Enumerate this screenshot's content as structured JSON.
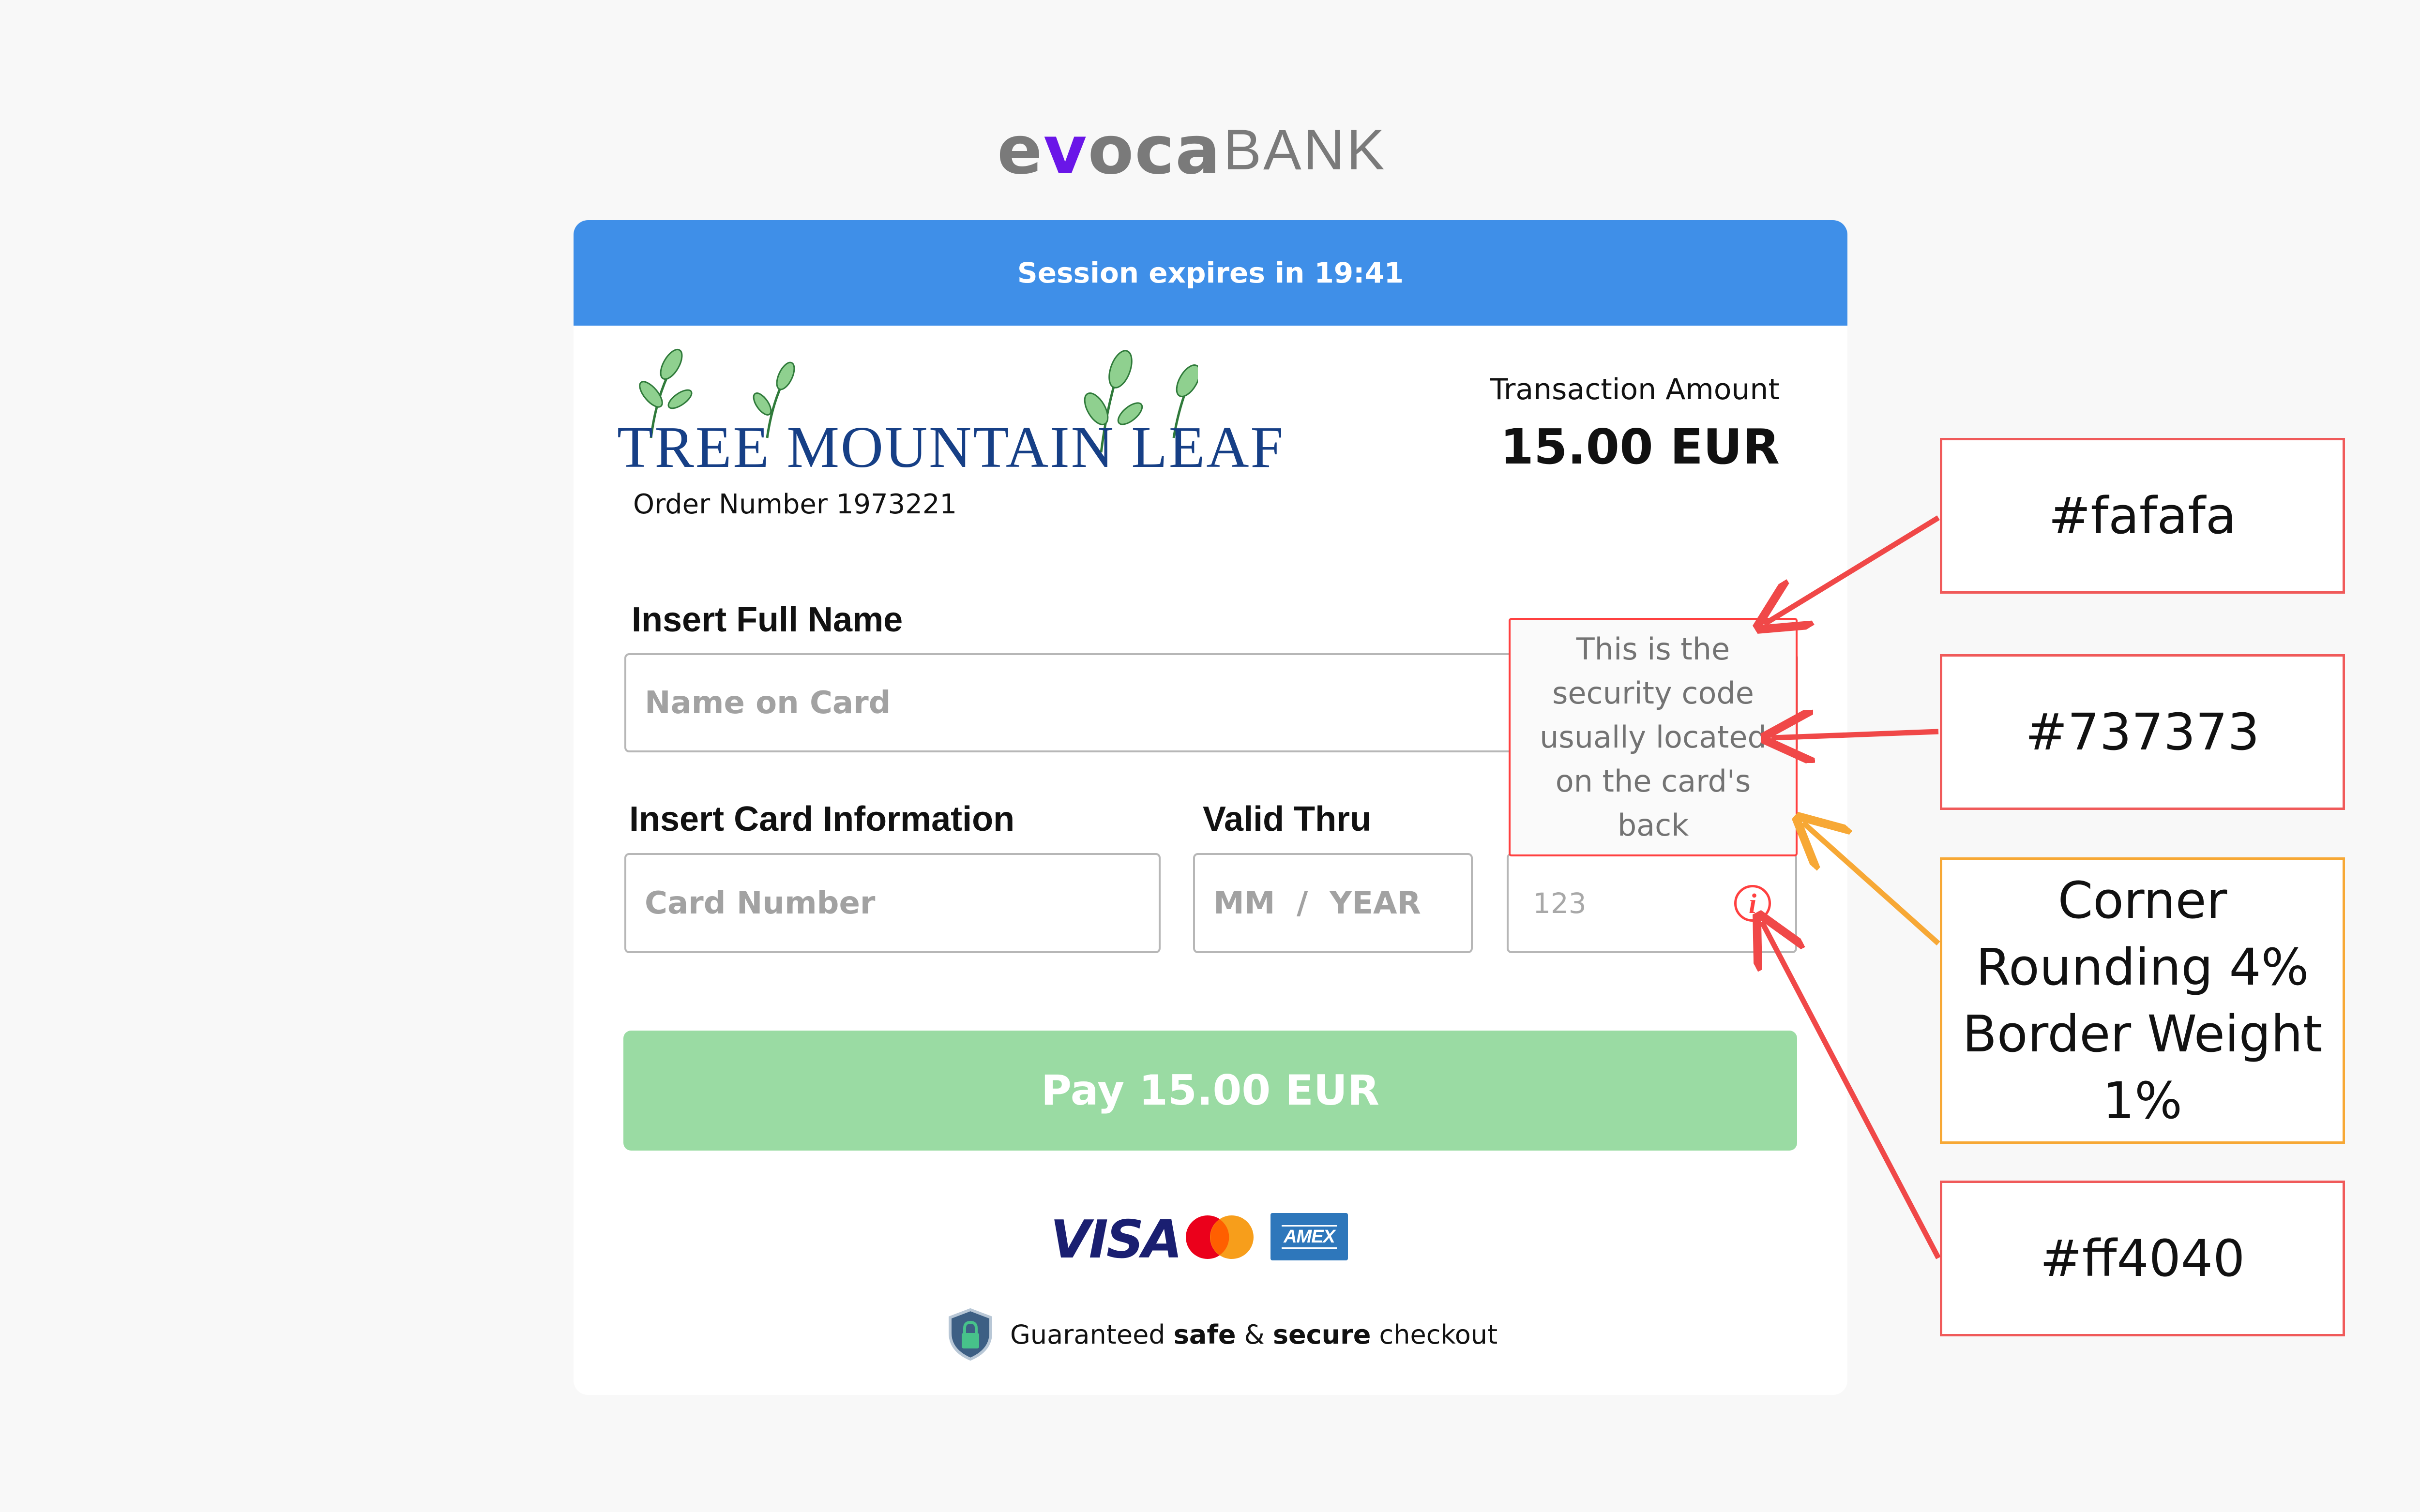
{
  "bank": {
    "logo_evoca_pre": "e",
    "logo_evoca_v": "v",
    "logo_evoca_post": "oca",
    "logo_bank": "BANK"
  },
  "session": {
    "text": "Session expires in 19:41"
  },
  "merchant": {
    "name": "TREE MOUNTAIN LEAF",
    "order_number": "Order Number 1973221"
  },
  "transaction": {
    "label": "Transaction Amount",
    "amount": "15.00 EUR"
  },
  "form": {
    "full_name_label": "Insert Full Name",
    "name_placeholder": "Name on Card",
    "card_info_label": "Insert Card Information",
    "card_number_placeholder": "Card Number",
    "valid_thru_label": "Valid Thru",
    "expiry_placeholder": "MM  /  YEAR",
    "cvv_placeholder": "123",
    "info_icon_glyph": "i"
  },
  "tooltip": {
    "text": "This is the security code usually located on the card's back"
  },
  "pay_button": {
    "label": "Pay 15.00 EUR"
  },
  "payment_methods": {
    "visa": "VISA",
    "amex": "AMEX"
  },
  "secure": {
    "prefix": "Guaranteed ",
    "safe": "safe",
    "amp": " & ",
    "secure": "secure",
    "suffix": " checkout"
  },
  "annotations": {
    "fill_color": "#fafafa",
    "text_color": "#737373",
    "corner": "Corner Rounding 4% Border Weight 1%",
    "icon_color": "#ff4040"
  },
  "colors": {
    "session_bar": "#3f8fe8",
    "pay_button": "#9adba3",
    "merchant_blue": "#163f86",
    "bank_purple": "#6a16e8",
    "annotation_red": "#f05a5a",
    "annotation_orange": "#f7a835"
  },
  "icons": [
    "shield-lock-icon",
    "info-icon",
    "mastercard-icon",
    "leaf-icon"
  ]
}
